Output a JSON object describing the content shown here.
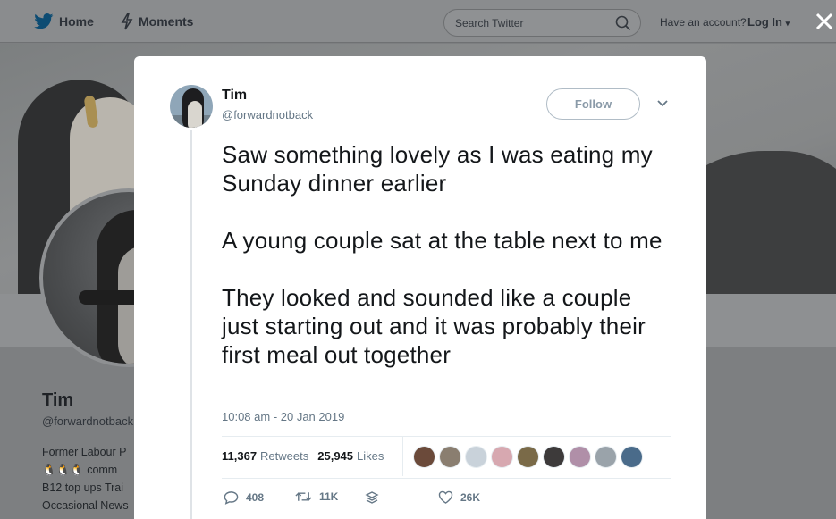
{
  "nav": {
    "home_label": "Home",
    "moments_label": "Moments",
    "search_placeholder": "Search Twitter",
    "account_prompt": "Have an account?",
    "login_label": "Log In"
  },
  "profile": {
    "name": "Tim",
    "handle": "@forwardnotback",
    "bio_lines": [
      "Former Labour P",
      "comm",
      "B12 top ups Trai",
      "Occasional News"
    ]
  },
  "tweet": {
    "author_name": "Tim",
    "author_handle": "@forwardnotback",
    "follow_label": "Follow",
    "paragraphs": [
      "Saw something lovely as I was eating my Sunday dinner earlier",
      "A young couple sat at the table next to me",
      "They looked and sounded like a couple just starting out and it was probably their first meal out together"
    ],
    "timestamp": "10:08 am - 20 Jan 2019",
    "retweets_count": "11,367",
    "retweets_label": "Retweets",
    "likes_count": "25,945",
    "likes_label": "Likes",
    "reply_count": "408",
    "retweet_action_count": "11K",
    "like_action_count": "26K"
  },
  "colors": {
    "accent": "#1da1f2",
    "text_primary": "#14171a",
    "text_secondary": "#657786",
    "liker_avatars": [
      "#6b4a3a",
      "#8a7e70",
      "#c9d2da",
      "#d7a8b0",
      "#7a6a48",
      "#3d3a3a",
      "#b08fa8",
      "#9aa3aa",
      "#4a6b8a"
    ]
  },
  "icons": {
    "home": "twitter-bird-icon",
    "moments": "lightning-icon",
    "search": "magnifier-icon",
    "close": "close-icon",
    "caret": "chevron-down-icon",
    "reply": "speech-bubble-icon",
    "retweet": "retweet-arrows-icon",
    "stack": "layers-icon",
    "like": "heart-icon"
  }
}
